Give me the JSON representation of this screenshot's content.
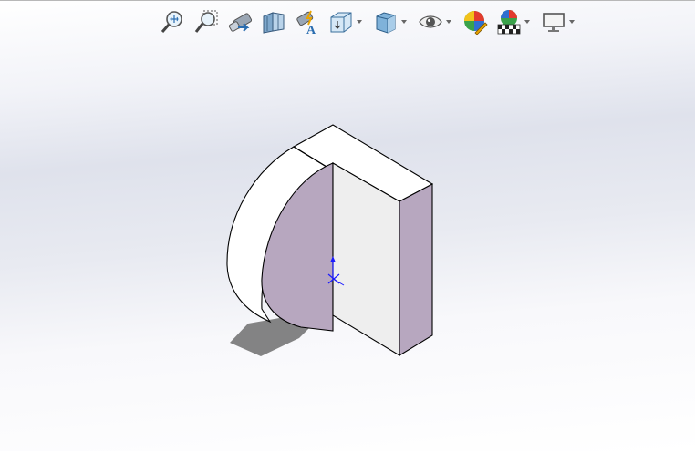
{
  "window": {
    "background_top": "#ffffff",
    "background_mid": "#dfe2ec"
  },
  "heads_up_toolbar": {
    "items": [
      {
        "icon": "zoom-to-fit-icon",
        "dropdown": false
      },
      {
        "icon": "zoom-to-area-icon",
        "dropdown": false
      },
      {
        "icon": "previous-view-icon",
        "dropdown": false
      },
      {
        "icon": "section-view-icon",
        "dropdown": false
      },
      {
        "icon": "dynamic-annotation-views-icon",
        "dropdown": false
      },
      {
        "icon": "view-orientation-icon",
        "dropdown": true
      },
      {
        "icon": "display-style-icon",
        "dropdown": true
      },
      {
        "icon": "hide-show-items-icon",
        "dropdown": true
      },
      {
        "icon": "edit-appearance-icon",
        "dropdown": false
      },
      {
        "icon": "apply-scene-icon",
        "dropdown": true
      },
      {
        "icon": "view-settings-icon",
        "dropdown": true
      }
    ]
  },
  "model": {
    "face_color_front": "#b7a7bf",
    "face_color_white": "#ffffff",
    "face_color_block": "#eeeeee",
    "shadow_color": "#6e6e6e",
    "origin_color": "#1a1aff"
  }
}
